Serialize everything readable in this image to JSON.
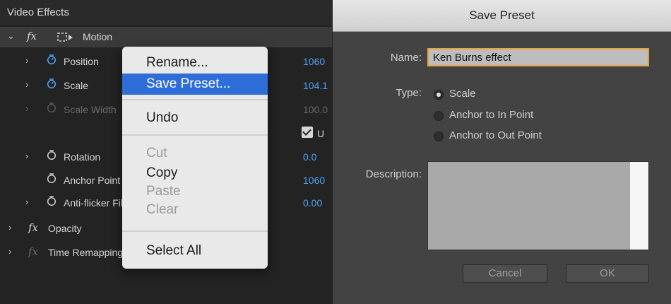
{
  "panel": {
    "title": "Video Effects",
    "motion_label": "Motion",
    "fx_glyph": "fx",
    "rows": [
      {
        "label": "Position",
        "value": "1060"
      },
      {
        "label": "Scale",
        "value": "104.1"
      },
      {
        "label": "Scale Width",
        "value": "100.0"
      },
      {
        "label": "Uniform Scale",
        "value": "U"
      },
      {
        "label": "Rotation",
        "value": "0.0"
      },
      {
        "label": "Anchor Point",
        "value": "1060"
      },
      {
        "label": "Anti-flicker Filter",
        "value": "0.00"
      }
    ],
    "opacity_label": "Opacity",
    "time_remap_label": "Time Remapping",
    "accent": "#4fa3f7"
  },
  "context_menu": {
    "items": {
      "rename": "Rename...",
      "save_preset": "Save Preset...",
      "undo": "Undo",
      "cut": "Cut",
      "copy": "Copy",
      "paste": "Paste",
      "clear": "Clear",
      "select_all": "Select All"
    },
    "selected": "save_preset",
    "highlight": "#2f6ed8"
  },
  "dialog": {
    "title": "Save Preset",
    "name_label": "Name:",
    "name_value": "Ken Burns effect",
    "type_label": "Type:",
    "types": [
      "Scale",
      "Anchor to In Point",
      "Anchor to Out Point"
    ],
    "selected_type": "Scale",
    "description_label": "Description:",
    "cancel": "Cancel",
    "ok": "OK",
    "focus_color": "#e8a33d"
  }
}
